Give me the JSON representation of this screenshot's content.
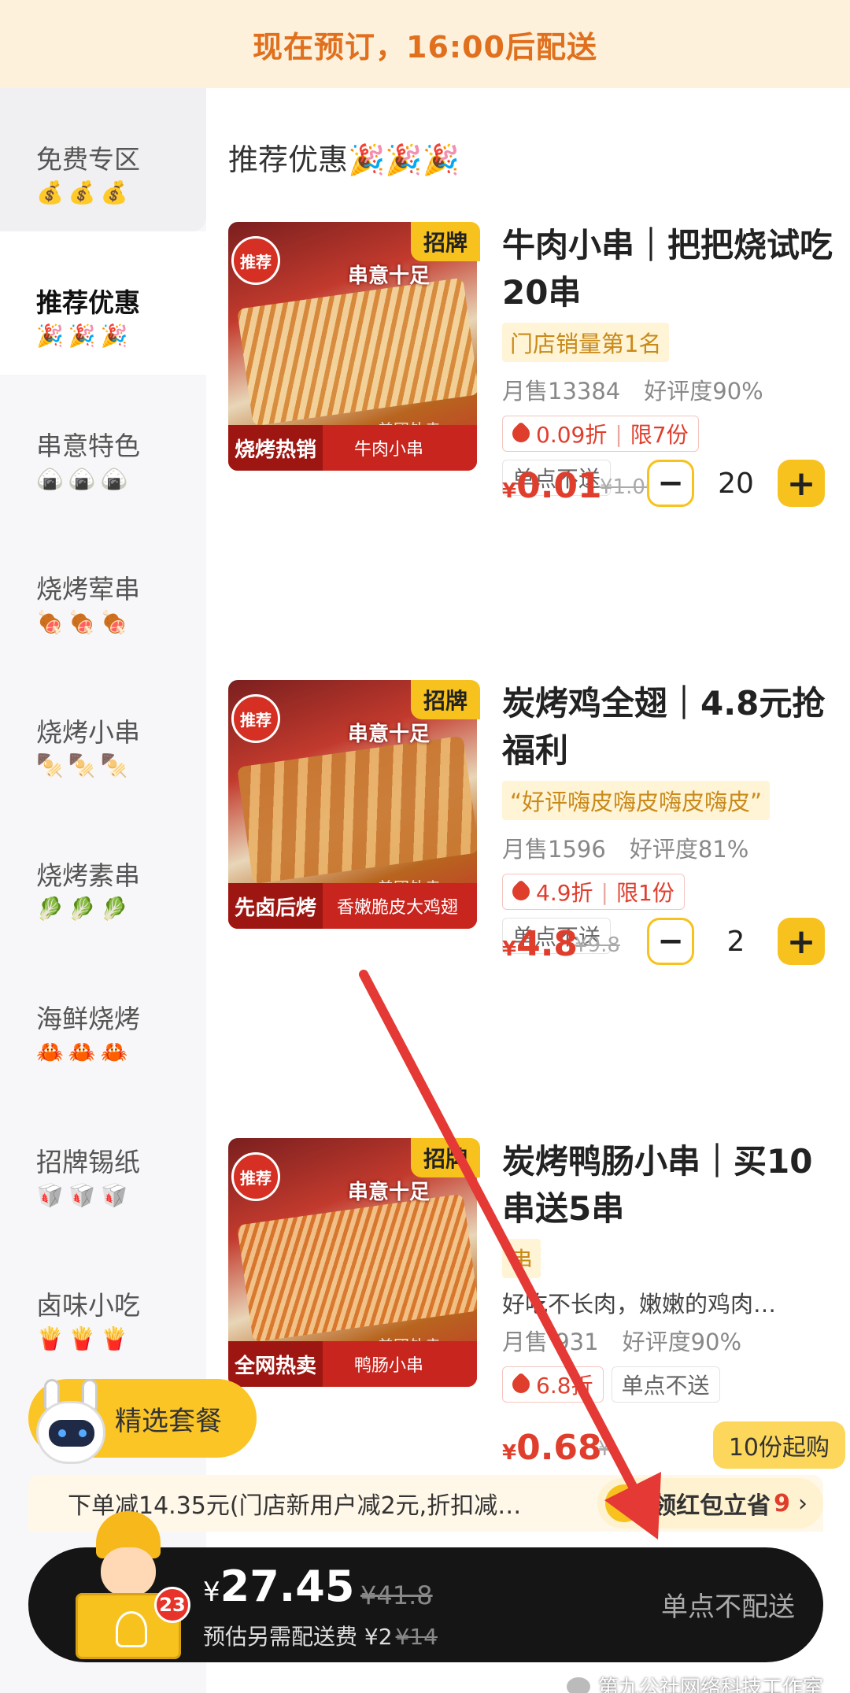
{
  "banner": {
    "text": "现在预订，16:00后配送"
  },
  "sidebar": {
    "items": [
      {
        "label": "免费专区",
        "emoji": "💰💰💰"
      },
      {
        "label": "推荐优惠",
        "emoji": "🎉🎉🎉"
      },
      {
        "label": "串意特色",
        "emoji": "🍙🍙🍙"
      },
      {
        "label": "烧烤荤串",
        "emoji": "🍖🍖🍖"
      },
      {
        "label": "烧烤小串",
        "emoji": "🍢🍢🍢"
      },
      {
        "label": "烧烤素串",
        "emoji": "🥬🥬🥬"
      },
      {
        "label": "海鲜烧烤",
        "emoji": "🦀🦀🦀"
      },
      {
        "label": "招牌锡纸",
        "emoji": "🥡🥡🥡"
      },
      {
        "label": "卤味小吃",
        "emoji": "🍟🍟🍟"
      }
    ]
  },
  "section_title": "推荐优惠🎉🎉🎉",
  "products": [
    {
      "badge": "招牌",
      "title": "牛肉小串｜把把烧试吃20串",
      "tagline": "门店销量第1名",
      "monthly_sales": "月售13384",
      "rating": "好评度90%",
      "discount": "0.09折",
      "limit": "限7份",
      "delivery_note": "单点不送",
      "price_symbol": "¥",
      "price": "0.01",
      "old_price": "¥1.06",
      "minus": "−",
      "quantity": "20",
      "plus": "+",
      "img": {
        "rec": "推荐",
        "brand": "串意十足",
        "tag_left": "烧烤热销",
        "tag_right": "牛肉小串",
        "watermark": "美团外卖"
      }
    },
    {
      "badge": "招牌",
      "title": "炭烤鸡全翅｜4.8元抢福利",
      "tagline": "“好评嗨皮嗨皮嗨皮嗨皮”",
      "monthly_sales": "月售1596",
      "rating": "好评度81%",
      "discount": "4.9折",
      "limit": "限1份",
      "delivery_note": "单点不送",
      "price_symbol": "¥",
      "price": "4.8",
      "old_price": "¥9.8",
      "minus": "−",
      "quantity": "2",
      "plus": "+",
      "img": {
        "rec": "推荐",
        "brand": "串意十足",
        "tag_left": "先卤后烤",
        "tag_right": "香嫩脆皮大鸡翅",
        "watermark": "美团外卖"
      }
    },
    {
      "badge": "招牌",
      "title": "炭烤鸭肠小串｜买10串送5串",
      "tagline": "串",
      "description": "好吃不长肉，嫩嫩的鸡肉…",
      "monthly_sales": "月售 931",
      "rating": "好评度90%",
      "discount": "6.8折",
      "delivery_note": "单点不送",
      "price_symbol": "¥",
      "price": "0.68",
      "old_price": "¥",
      "min_order": "10份起购",
      "img": {
        "rec": "推荐",
        "brand": "串意十足",
        "tag_left": "全网热卖",
        "tag_right": "鸭肠小串",
        "watermark": "美团外卖"
      }
    }
  ],
  "combo_button": "精选套餐",
  "promo": {
    "text": "下单减14.35元(门店新用户减2元,折扣减…",
    "redpack_label": "领红包立省",
    "redpack_count": "9",
    "chevron": "›"
  },
  "cart": {
    "badge_count": "23",
    "total_symbol": "¥",
    "total": "27.45",
    "old_total": "¥41.8",
    "fee_label": "预估另需配送费 ¥2",
    "fee_old": "¥14",
    "status": "单点不配送"
  },
  "watermark": "第九公社网络科技工作室",
  "colors": {
    "accent": "#f7c21e",
    "price": "#e03e2d",
    "banner_text": "#e0701d",
    "cart_bg": "#151515",
    "arrow": "#e53935"
  }
}
